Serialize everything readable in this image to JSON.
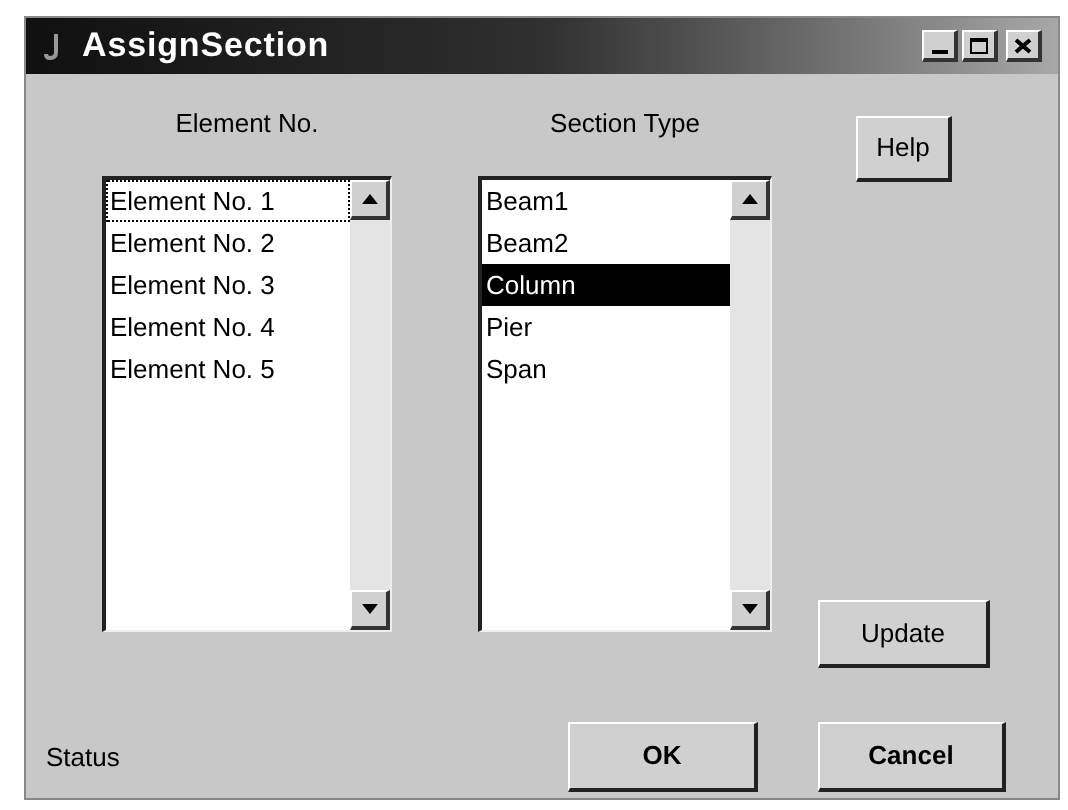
{
  "window": {
    "title": "AssignSection"
  },
  "element_list": {
    "label": "Element No.",
    "items": [
      {
        "text": "Element No. 1",
        "selected": false,
        "focused": true
      },
      {
        "text": "Element No. 2",
        "selected": false,
        "focused": false
      },
      {
        "text": "Element No. 3",
        "selected": false,
        "focused": false
      },
      {
        "text": "Element No. 4",
        "selected": false,
        "focused": false
      },
      {
        "text": "Element No. 5",
        "selected": false,
        "focused": false
      }
    ]
  },
  "section_list": {
    "label": "Section Type",
    "items": [
      {
        "text": "Beam1",
        "selected": false,
        "focused": false
      },
      {
        "text": "Beam2",
        "selected": false,
        "focused": false
      },
      {
        "text": "Column",
        "selected": true,
        "focused": false
      },
      {
        "text": "Pier",
        "selected": false,
        "focused": false
      },
      {
        "text": "Span",
        "selected": false,
        "focused": false
      }
    ]
  },
  "buttons": {
    "help": "Help",
    "update": "Update",
    "ok": "OK",
    "cancel": "Cancel"
  },
  "status": "Status"
}
